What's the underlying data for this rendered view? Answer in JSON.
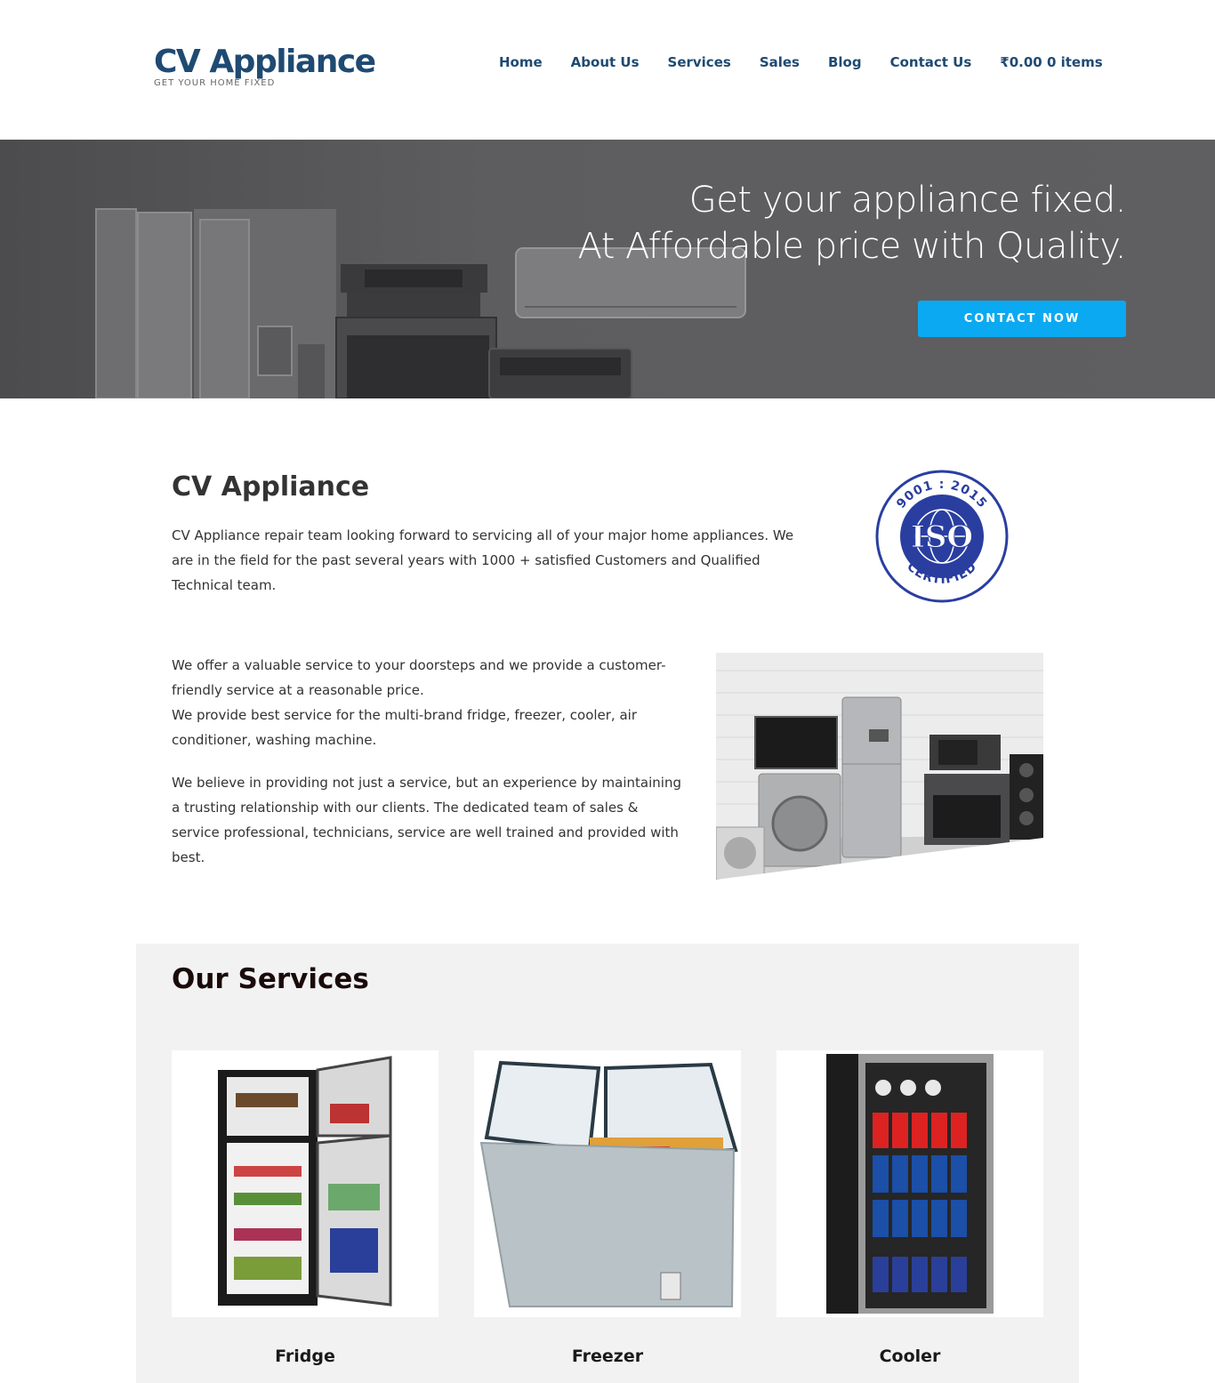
{
  "header": {
    "logo_title": "CV Appliance",
    "logo_tagline": "GET YOUR HOME FIXED",
    "nav": [
      "Home",
      "About Us",
      "Services",
      "Sales",
      "Blog",
      "Contact Us",
      "₹0.00 0 items"
    ]
  },
  "hero": {
    "line1": "Get your appliance fixed.",
    "line2": "At Affordable price with Quality.",
    "cta_label": "CONTACT NOW"
  },
  "about": {
    "title": "CV Appliance",
    "paragraph": "CV Appliance repair team looking forward to servicing all of your major home appliances. We are in the field for the past several years with 1000 + satisfied Customers and Qualified Technical team.",
    "iso_top": "9001 : 2015",
    "iso_center": "ISO",
    "iso_bottom": "CERTIFIED"
  },
  "offer": {
    "p1_line1": "We offer a valuable service to your doorsteps and we provide a customer-friendly service at a reasonable price.",
    "p1_line2": "We provide best service for the multi-brand fridge, freezer, cooler, air conditioner, washing machine.",
    "p2": "We believe in providing not just a service, but an experience by maintaining a trusting relationship with our clients. The dedicated team of sales & service professional, technicians, service are well trained and provided with best."
  },
  "services": {
    "title": "Our Services",
    "items": [
      {
        "label": "Fridge"
      },
      {
        "label": "Freezer"
      },
      {
        "label": "Cooler"
      }
    ]
  },
  "colors": {
    "brand": "#1f4a72",
    "cta": "#0ba9f2",
    "hero_bg": "#5d5d5f",
    "services_bg": "#f2f2f2",
    "iso_blue": "#2a3ea0"
  }
}
